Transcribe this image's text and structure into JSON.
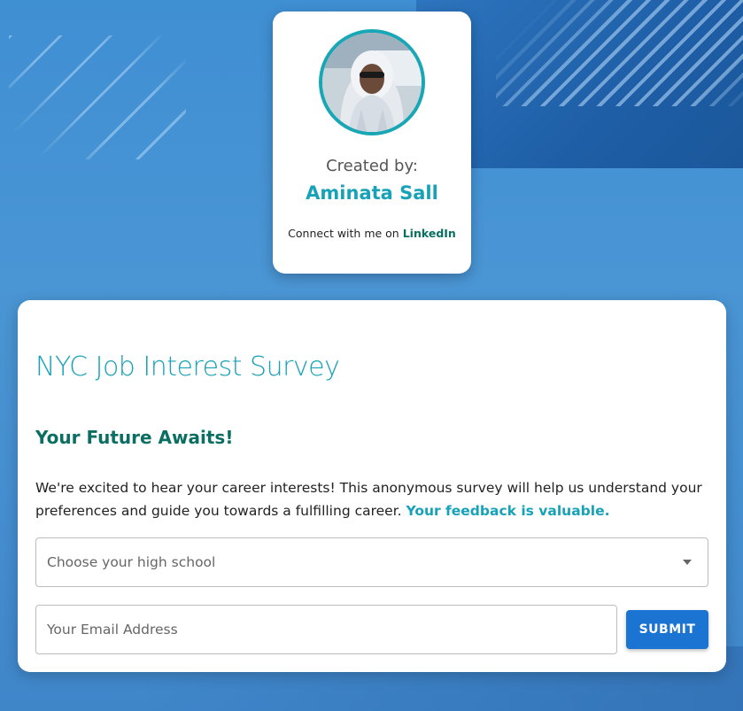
{
  "creator": {
    "created_by_label": "Created by:",
    "name": "Aminata Sall",
    "connect_text": "Connect with me on ",
    "connect_link": "LinkedIn",
    "avatar_icon": "profile-photo"
  },
  "survey": {
    "title": "NYC Job Interest Survey",
    "subtitle": "Your Future Awaits!",
    "description": "We're excited to hear your career interests! This anonymous survey will help us understand your preferences and guide you towards a fulfilling career. ",
    "description_highlight": "Your feedback is valuable.",
    "school_select": {
      "placeholder": "Choose your high school",
      "icon": "caret-down-icon"
    },
    "email_input": {
      "placeholder": "Your Email Address",
      "value": ""
    },
    "submit_label": "SUBMIT"
  },
  "colors": {
    "accent_teal": "#17a2b8",
    "dark_green": "#0b6e62",
    "button_blue": "#1b74d2",
    "background_blue": "#4a95d4"
  }
}
